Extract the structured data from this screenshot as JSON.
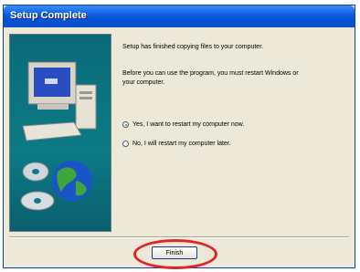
{
  "window": {
    "title": "Setup Complete"
  },
  "content": {
    "line1": "Setup has finished copying files to your computer.",
    "line2a": "Before you can use the program, you must restart Windows or",
    "line2b": "your computer."
  },
  "options": [
    {
      "label": "Yes, I want to restart my computer now.",
      "selected": true
    },
    {
      "label": "No, I will restart my computer later.",
      "selected": false
    }
  ],
  "buttons": {
    "finish": "Finish"
  },
  "colors": {
    "title_bar": "#0a5ee0",
    "highlight": "#e0262a",
    "side_panel": "#0c7a86"
  },
  "icons": [
    "computer-illustration",
    "globe-icon",
    "cd-disc-icon"
  ]
}
